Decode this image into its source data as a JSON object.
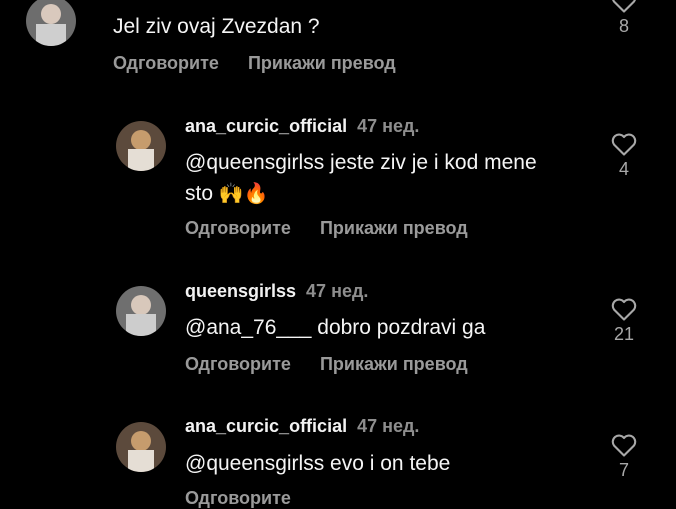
{
  "comments": [
    {
      "username": "",
      "time": "",
      "text": "Jel ziv ovaj Zvezdan ?",
      "emoji": "",
      "reply_label": "Одговорите",
      "translate_label": "Прикажи превод",
      "likes": "8"
    },
    {
      "username": "ana_curcic_official",
      "time": "47 нед.",
      "text": "@queensgirlss jeste ziv je i kod mene sto",
      "emoji": "🙌🔥",
      "reply_label": "Одговорите",
      "translate_label": "Прикажи превод",
      "likes": "4"
    },
    {
      "username": "queensgirlss",
      "time": "47 нед.",
      "text": "@ana_76___ dobro pozdravi ga",
      "emoji": "",
      "reply_label": "Одговорите",
      "translate_label": "Прикажи превод",
      "likes": "21"
    },
    {
      "username": "ana_curcic_official",
      "time": "47 нед.",
      "text": "@queensgirlss evo i on tebe",
      "emoji": "",
      "reply_label": "Одговорите",
      "translate_label": "",
      "likes": "7"
    }
  ],
  "icons": {
    "like": "heart-outline-icon"
  },
  "colors": {
    "background": "#000000",
    "text": "#f5f5f5",
    "muted": "#9a9a9a"
  }
}
